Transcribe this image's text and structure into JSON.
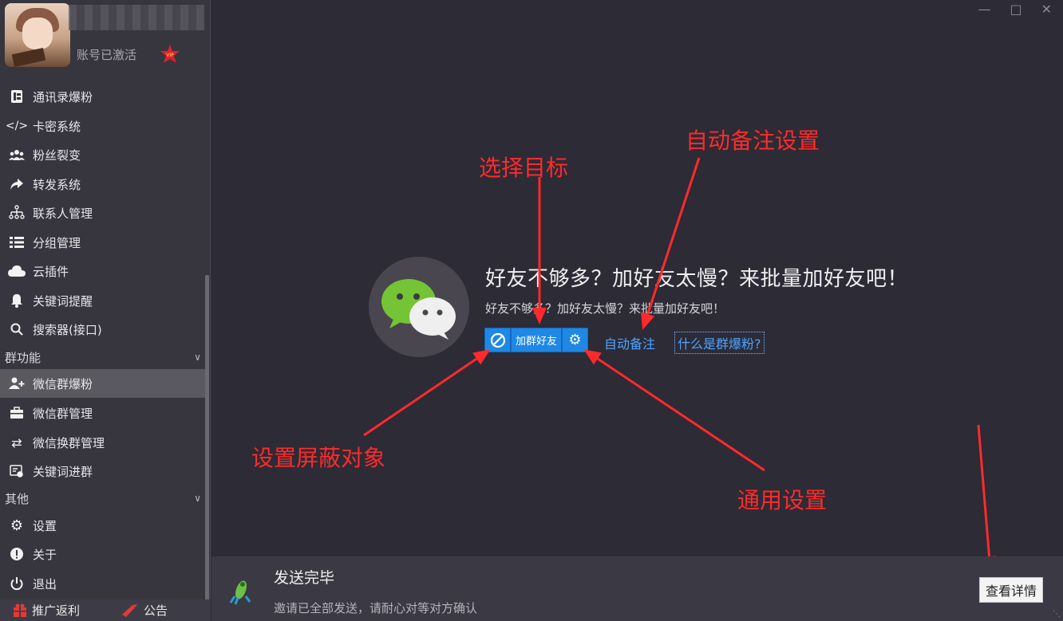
{
  "profile": {
    "account_status": "账号已激活",
    "vip_label": "VIP"
  },
  "sidebar": {
    "items": [
      {
        "label": "通讯录爆粉",
        "icon": "contacts-book-icon"
      },
      {
        "label": "卡密系统",
        "icon": "code-icon"
      },
      {
        "label": "粉丝裂变",
        "icon": "users-group-icon"
      },
      {
        "label": "转发系统",
        "icon": "forward-arrow-icon"
      },
      {
        "label": "联系人管理",
        "icon": "org-chart-icon"
      },
      {
        "label": "分组管理",
        "icon": "list-icon"
      },
      {
        "label": "云插件",
        "icon": "cloud-icon"
      },
      {
        "label": "关键词提醒",
        "icon": "bell-icon"
      },
      {
        "label": "搜索器(接口)",
        "icon": "search-icon"
      }
    ],
    "group_section": {
      "title": "群功能",
      "items": [
        {
          "label": "微信群爆粉",
          "icon": "add-user-icon",
          "active": true
        },
        {
          "label": "微信群管理",
          "icon": "briefcase-icon"
        },
        {
          "label": "微信换群管理",
          "icon": "swap-icon"
        },
        {
          "label": "关键词进群",
          "icon": "keyword-group-icon"
        }
      ]
    },
    "other_section": {
      "title": "其他",
      "items": [
        {
          "label": "设置",
          "icon": "gear-icon"
        },
        {
          "label": "关于",
          "icon": "info-icon"
        },
        {
          "label": "退出",
          "icon": "power-icon"
        }
      ]
    },
    "footer": {
      "promo_label": "推广返利",
      "notice_label": "公告"
    }
  },
  "main": {
    "headline": "好友不够多？加好友太慢？来批量加好友吧！",
    "subline": "好友不够多？加好友太慢？来批量加好友吧！",
    "add_group_friend_label": "加群好友",
    "auto_remark_label": "自动备注",
    "what_is_label": "什么是群爆粉?"
  },
  "annotations": {
    "select_target": "选择目标",
    "auto_remark_settings": "自动备注设置",
    "set_block": "设置屏蔽对象",
    "general_settings": "通用设置"
  },
  "status_bar": {
    "title": "发送完毕",
    "description": "邀请已全部发送，请耐心对等对方确认",
    "details_button": "查看详情"
  },
  "colors": {
    "accent_blue": "#1e88e5",
    "annotation_red": "#ff2a2a",
    "link_blue": "#4ea3ff",
    "background": "#2c2b36"
  }
}
